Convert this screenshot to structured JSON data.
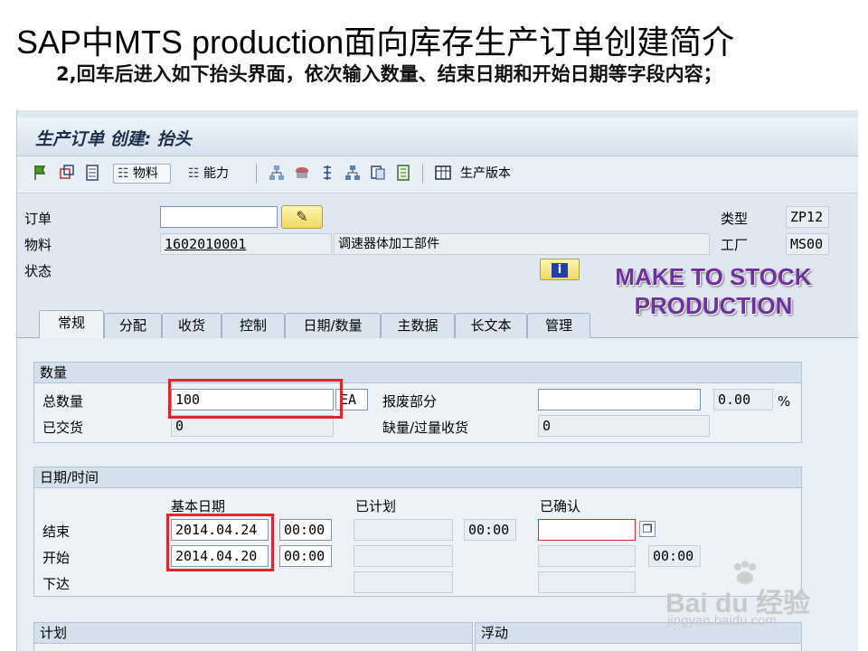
{
  "slide": {
    "title": "SAP中MTS production面向库存生产订单创建简介",
    "subtitle": "2,回车后进入如下抬头界面，依次输入数量、结束日期和开始日期等字段内容；"
  },
  "window": {
    "title": "生产订单 创建: 抬头"
  },
  "toolbar": {
    "material_button": "物料",
    "capacity_button": "能力",
    "production_version": "生产版本"
  },
  "header": {
    "order_label": "订单",
    "order_value": "",
    "material_label": "物料",
    "material_value": "1602010001",
    "material_desc": "调速器体加工部件",
    "status_label": "状态",
    "type_label": "类型",
    "type_value": "ZP12",
    "plant_label": "工厂",
    "plant_value": "MS00"
  },
  "overlay": {
    "line1": "MAKE TO STOCK",
    "line2": "PRODUCTION"
  },
  "tabs": [
    {
      "label": "常规",
      "active": true
    },
    {
      "label": "分配"
    },
    {
      "label": "收货"
    },
    {
      "label": "控制"
    },
    {
      "label": "日期/数量"
    },
    {
      "label": "主数据"
    },
    {
      "label": "长文本"
    },
    {
      "label": "管理"
    }
  ],
  "quantity": {
    "section_title": "数量",
    "total_label": "总数量",
    "total_value": "100",
    "unit": "EA",
    "scrap_label": "报废部分",
    "scrap_value": "",
    "scrap_pct": "0.00",
    "pct_sign": "%",
    "delivered_label": "已交货",
    "delivered_value": "0",
    "short_over_label": "缺量/过量收货",
    "short_over_value": "0"
  },
  "dates": {
    "section_title": "日期/时间",
    "basic_header": "基本日期",
    "scheduled_header": "已计划",
    "confirmed_header": "已确认",
    "finish_label": "结束",
    "start_label": "开始",
    "release_label": "下达",
    "finish_date": "2014.04.24",
    "finish_time": "00:00",
    "start_date": "2014.04.20",
    "start_time": "00:00",
    "sched_finish_time": "00:00",
    "conf_start_time": "00:00"
  },
  "bottom": {
    "plan_label": "计划",
    "move_label": "浮动"
  },
  "watermark": {
    "brand": "Bai du 经验",
    "url": "jingyan.baidu.com"
  },
  "colors": {
    "highlight": "#e0262c",
    "overlay_text": "#7030a0",
    "sap_bg": "#dfe8f1"
  }
}
